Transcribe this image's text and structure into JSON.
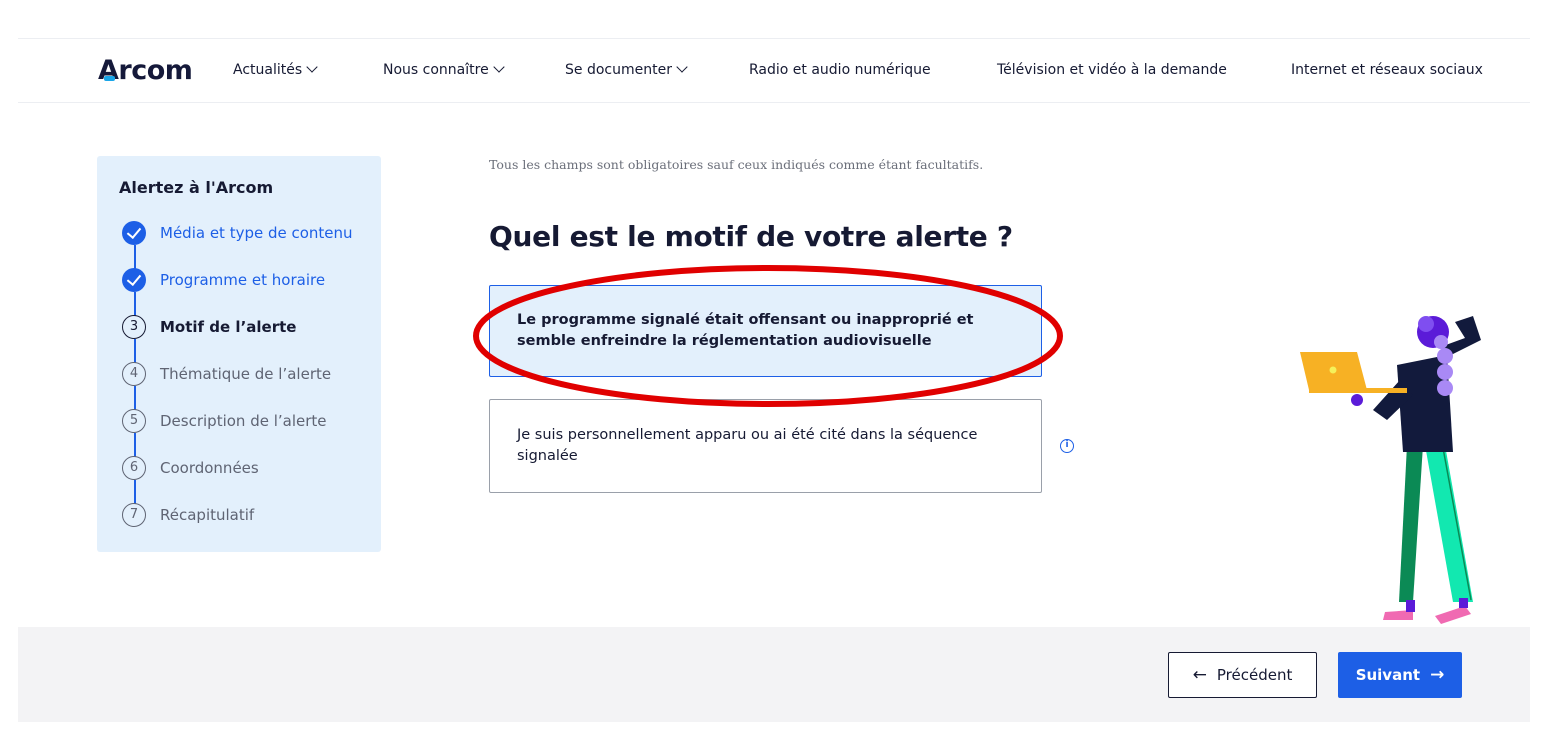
{
  "header": {
    "logo": "Arcom",
    "nav": [
      {
        "label": "Actualités",
        "dropdown": true
      },
      {
        "label": "Nous connaître",
        "dropdown": true
      },
      {
        "label": "Se documenter",
        "dropdown": true
      },
      {
        "label": "Radio et audio numérique",
        "dropdown": false
      },
      {
        "label": "Télévision et vidéo à la demande",
        "dropdown": false
      },
      {
        "label": "Internet et réseaux sociaux",
        "dropdown": false
      }
    ]
  },
  "stepper": {
    "title": "Alertez à l'Arcom",
    "steps": [
      {
        "number": "1",
        "label": "Média et type de contenu",
        "state": "done"
      },
      {
        "number": "2",
        "label": "Programme et horaire",
        "state": "done"
      },
      {
        "number": "3",
        "label": "Motif de l’alerte",
        "state": "current"
      },
      {
        "number": "4",
        "label": "Thématique de l’alerte",
        "state": "todo"
      },
      {
        "number": "5",
        "label": "Description de l’alerte",
        "state": "todo"
      },
      {
        "number": "6",
        "label": "Coordonnées",
        "state": "todo"
      },
      {
        "number": "7",
        "label": "Récapitulatif",
        "state": "todo"
      }
    ]
  },
  "form": {
    "required_note": "Tous les champs sont obligatoires sauf ceux indiqués comme étant facultatifs.",
    "question": "Quel est le motif de votre alerte ?",
    "options": [
      {
        "label": "Le programme signalé était offensant ou inapproprié et semble enfreindre la réglementation audiovisuelle",
        "selected": true
      },
      {
        "label": "Je suis personnellement apparu ou ai été cité dans la séquence signalée",
        "selected": false
      }
    ],
    "info_icon": "info-icon"
  },
  "footer": {
    "prev_label": "Précédent",
    "next_label": "Suivant"
  },
  "colors": {
    "accent": "#1d5fe6",
    "stepper_bg": "#e3f0fc",
    "highlight": "#e00000",
    "footer_bg": "#f3f3f5"
  }
}
